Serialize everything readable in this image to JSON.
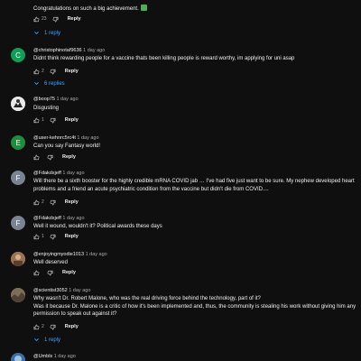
{
  "comments": [
    {
      "text": "Congratulations on such a big achievement.",
      "likes": "23",
      "reply_label": "Reply",
      "replies_label": "1 reply"
    },
    {
      "avatar_letter": "C",
      "avatar_color": "#0f9d58",
      "handle": "@christophinotaf9636",
      "time": "1 day ago",
      "text": "Didnt think rewarding people for a vaccine thats been killing people is reward worthy, im applying for uni asap",
      "likes": "2",
      "reply_label": "Reply",
      "replies_label": "6 replies"
    },
    {
      "avatar_color": "#e0e0e0",
      "handle": "@boop75",
      "time": "1 day ago",
      "text": "Disgusting",
      "likes": "1",
      "reply_label": "Reply"
    },
    {
      "avatar_letter": "E",
      "avatar_color": "#1e8e3e",
      "handle": "@user-kehnrc5rc4t",
      "time": "1 day ago",
      "text": "Can you say Fantasy world!",
      "likes": "",
      "reply_label": "Reply"
    },
    {
      "avatar_letter": "F",
      "avatar_color": "#7a8391",
      "handle": "@Fdakdsjeff",
      "time": "1 day ago",
      "text": "Will there be a sixth booster for the highly credible mRNA COVID jab … I've had five just want to be sure.  My nephew developed heart problems and a friend an acute psychiatric condition from the vaccine but didn't die from COVID....",
      "likes": "2",
      "reply_label": "Reply"
    },
    {
      "avatar_letter": "F",
      "avatar_color": "#7a8391",
      "handle": "@Fdakdsjeff",
      "time": "1 day ago",
      "text": "Well it wound, wouldn't it?  Political awards these days",
      "likes": "1",
      "reply_label": "Reply"
    },
    {
      "avatar_color": "#b08060",
      "handle": "@enjoyingmyodie1013",
      "time": "1 day ago",
      "text": "Well deserved",
      "likes": "",
      "reply_label": "Reply"
    },
    {
      "avatar_color": "#8a7a60",
      "handle": "@scientist3052",
      "time": "1 day ago",
      "text": "Why wasn't Dr. Robert Malone, who was the real driving force behind the technology, part of it?\nWas it because Dr. Malone is a critic of how it's been implemented and, thus, the community is stealing his work without giving him any permission to speak out against it?",
      "likes": "2",
      "reply_label": "Reply",
      "replies_label": "1 reply"
    },
    {
      "avatar_color": "#3a6ea5",
      "handle": "@Umbls",
      "time": "1 day ago"
    }
  ]
}
